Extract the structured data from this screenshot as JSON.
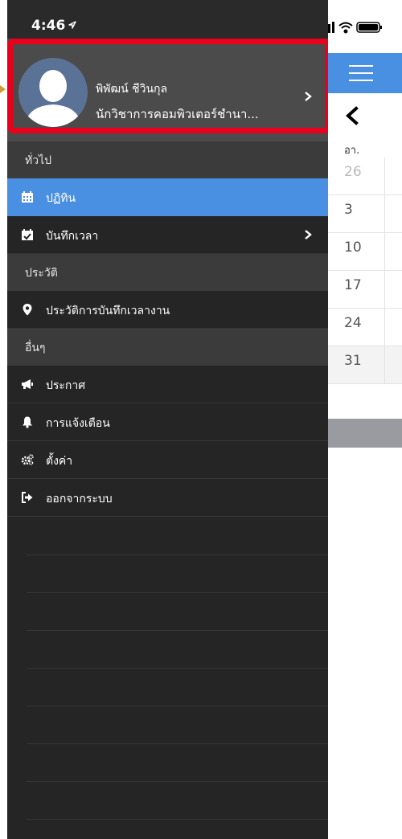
{
  "status_bar": {
    "time": "4:46"
  },
  "profile": {
    "name": "พิพัฒน์ ชีวินกุล",
    "title": "นักวิชาการคอมพิวเตอร์ชำนา..."
  },
  "menu": {
    "section_general": "ทั่วไป",
    "section_history": "ประวัติ",
    "section_other": "อื่นๆ",
    "items": [
      {
        "label": "ปฏิทิน",
        "icon": "calendar-icon"
      },
      {
        "label": "บันทึกเวลา",
        "icon": "calendar-check-icon"
      },
      {
        "label": "ประวัติการบันทึกเวลางาน",
        "icon": "map-marker-icon"
      },
      {
        "label": "ประกาศ",
        "icon": "megaphone-icon"
      },
      {
        "label": "การแจ้งเตือน",
        "icon": "bell-icon"
      },
      {
        "label": "ตั้งค่า",
        "icon": "gears-icon"
      },
      {
        "label": "ออกจากระบบ",
        "icon": "sign-out-icon"
      }
    ]
  },
  "calendar": {
    "day_header": "อา.",
    "dates": [
      "26",
      "3",
      "10",
      "17",
      "24",
      "31"
    ]
  },
  "colors": {
    "accent": "#4a90e2",
    "drawer_bg": "#252525",
    "section_bg": "#3b3b3b",
    "profile_bg": "#4b4b4b",
    "highlight": "#e8001c"
  }
}
